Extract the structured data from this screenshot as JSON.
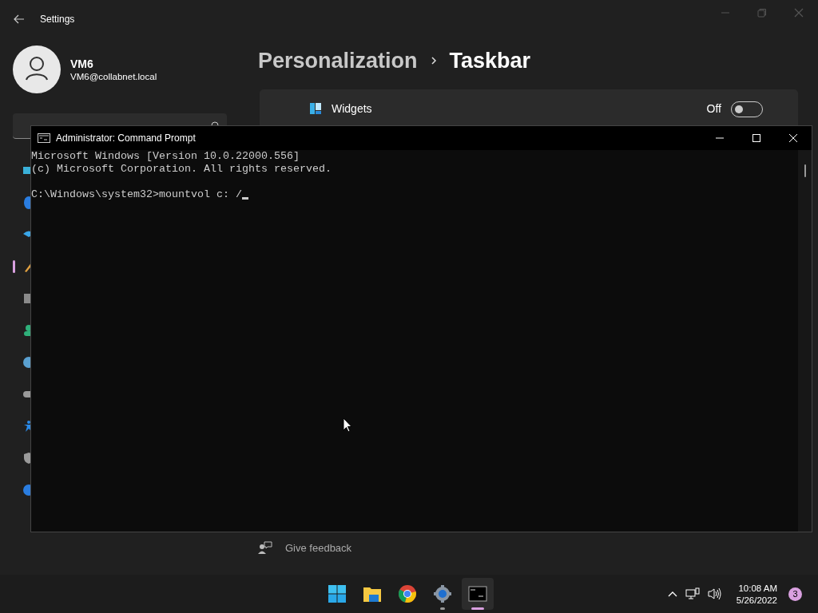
{
  "settings_window": {
    "title": "Settings",
    "user": {
      "name": "VM6",
      "email": "VM6@collabnet.local"
    },
    "nav_items": [
      {
        "kind": "system",
        "selected": false
      },
      {
        "kind": "bluetooth",
        "selected": false
      },
      {
        "kind": "network",
        "selected": false
      },
      {
        "kind": "personalization",
        "selected": true
      },
      {
        "kind": "apps",
        "selected": false
      },
      {
        "kind": "accounts",
        "selected": false
      },
      {
        "kind": "time",
        "selected": false
      },
      {
        "kind": "gaming",
        "selected": false
      },
      {
        "kind": "accessibility",
        "selected": false
      },
      {
        "kind": "privacy",
        "selected": false
      },
      {
        "kind": "update",
        "selected": false
      }
    ],
    "breadcrumb": [
      "Personalization",
      "Taskbar"
    ],
    "settings": [
      {
        "label": "Widgets",
        "state_text": "Off",
        "on": false
      }
    ],
    "feedback": "Give feedback"
  },
  "console_window": {
    "title": "Administrator: Command Prompt",
    "header_lines": [
      "Microsoft Windows [Version 10.0.22000.556]",
      "(c) Microsoft Corporation. All rights reserved."
    ],
    "command_line": "C:\\Windows\\system32>mountvol c: /"
  },
  "taskbar": {
    "apps": [
      {
        "kind": "start",
        "running": false,
        "selected": false
      },
      {
        "kind": "explorer",
        "running": false,
        "selected": false
      },
      {
        "kind": "chrome",
        "running": false,
        "selected": false
      },
      {
        "kind": "settings",
        "running": true,
        "selected": false
      },
      {
        "kind": "terminal",
        "running": true,
        "selected": true
      }
    ],
    "time": "10:08 AM",
    "date": "5/26/2022",
    "notification_count": "3"
  }
}
